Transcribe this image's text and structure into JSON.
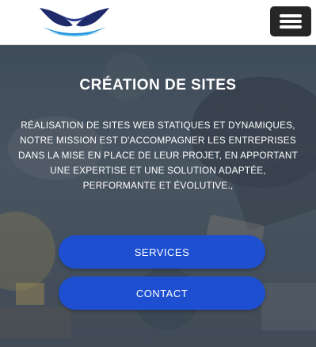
{
  "header": {
    "logo_icon": "brand-logo-icon",
    "menu_icon": "hamburger-menu-icon"
  },
  "hero": {
    "title": "CRÉATION DE SITES",
    "description": "RÉALISATION DE SITES WEB STATIQUES ET DYNAMIQUES, NOTRE MISSION EST D'ACCOMPAGNER LES ENTREPRISES DANS LA MISE EN PLACE DE LEUR PROJET, EN APPORTANT UNE EXPERTISE ET UNE SOLUTION ADAPTÉE, PERFORMANTE ET ÉVOLUTIVE.,",
    "buttons": {
      "services": "SERVICES",
      "contact": "CONTACT"
    }
  },
  "colors": {
    "button": "#1d4fd0",
    "menu_button": "#262626",
    "logo_navy": "#1f2a6b",
    "logo_blue": "#1f8fd6"
  }
}
